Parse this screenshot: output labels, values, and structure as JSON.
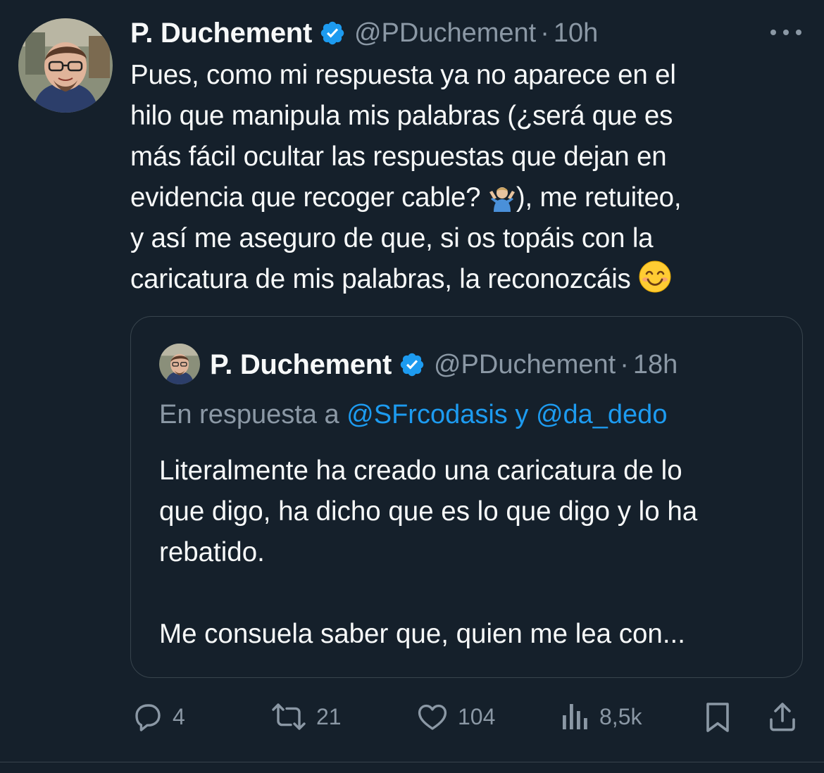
{
  "tweet": {
    "author_name": "P. Duchement",
    "handle": "@PDuchement",
    "separator": "·",
    "time": "10h",
    "text_lines": [
      "Pues, como mi respuesta ya no aparece en el",
      "hilo que manipula mis palabras (¿será que es",
      "más fácil ocultar las respuestas que dejan en",
      "evidencia que recoger cable?",
      "), me retuiteo,",
      "y así me aseguro de que, si os topáis con la",
      "caricatura de mis palabras, la reconozcáis"
    ],
    "emoji_shrug": "man-shrugging-emoji",
    "emoji_smile": "smiling-face-emoji"
  },
  "quote": {
    "author_name": "P. Duchement",
    "handle": "@PDuchement",
    "separator": "·",
    "time": "18h",
    "reply_prefix": "En respuesta a",
    "reply_user_1": "@SFrcodasis",
    "reply_conj": "y",
    "reply_user_2": "@da_dedo",
    "text_lines": [
      "Literalmente ha creado una caricatura de lo",
      "que digo, ha dicho que es lo que digo y lo ha",
      "rebatido.",
      "",
      "Me consuela saber que, quien me lea con..."
    ]
  },
  "actions": {
    "replies": "4",
    "retweets": "21",
    "likes": "104",
    "views": "8,5k"
  },
  "colors": {
    "background": "#15202b",
    "text": "#f7f9f9",
    "muted": "#8b98a5",
    "link": "#1d9bf0",
    "verified": "#1d9bf0",
    "border": "#38444d"
  }
}
